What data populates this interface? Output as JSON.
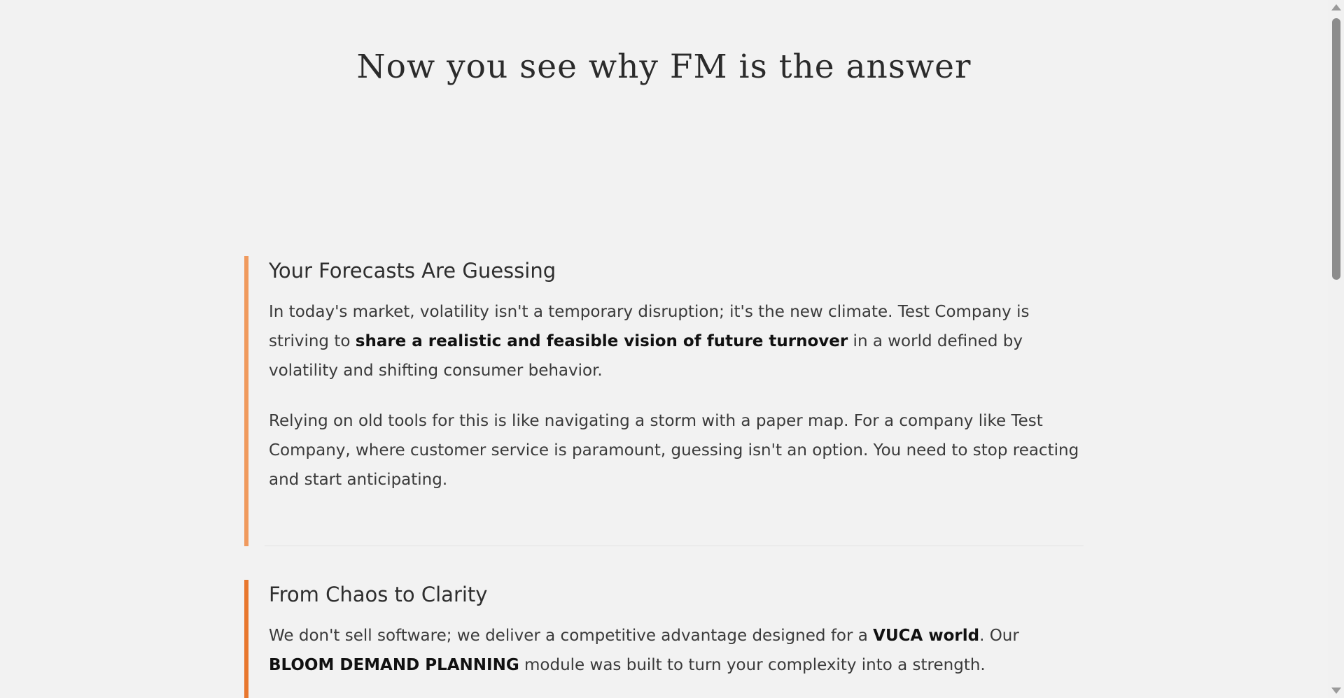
{
  "hero": {
    "title": "Now you see why FM is the answer"
  },
  "sections": [
    {
      "heading": "Your Forecasts Are Guessing",
      "accent_color": "#f09a5e",
      "p1": {
        "before": "In today's market, volatility isn't a temporary disruption; it's the new climate. Test Company is striving to ",
        "bold": "share a realistic and feasible vision of future turnover",
        "after": " in a world defined by volatility and shifting consumer behavior."
      },
      "p2": "Relying on old tools for this is like navigating a storm with a paper map. For a company like Test Company, where customer service is paramount, guessing isn't an option. You need to stop reacting and start anticipating."
    },
    {
      "heading": "From Chaos to Clarity",
      "accent_color": "#e8772e",
      "p1": {
        "before": "We don't sell software; we deliver a competitive advantage designed for a ",
        "bold1": "VUCA world",
        "middle": ". Our ",
        "bold2": "BLOOM DEMAND PLANNING",
        "after": " module was built to turn your complexity into a strength."
      }
    }
  ],
  "scrollbar": {
    "up_icon": "triangle-up-icon",
    "down_icon": "triangle-down-icon",
    "thumb_color": "#8c8c8c"
  }
}
